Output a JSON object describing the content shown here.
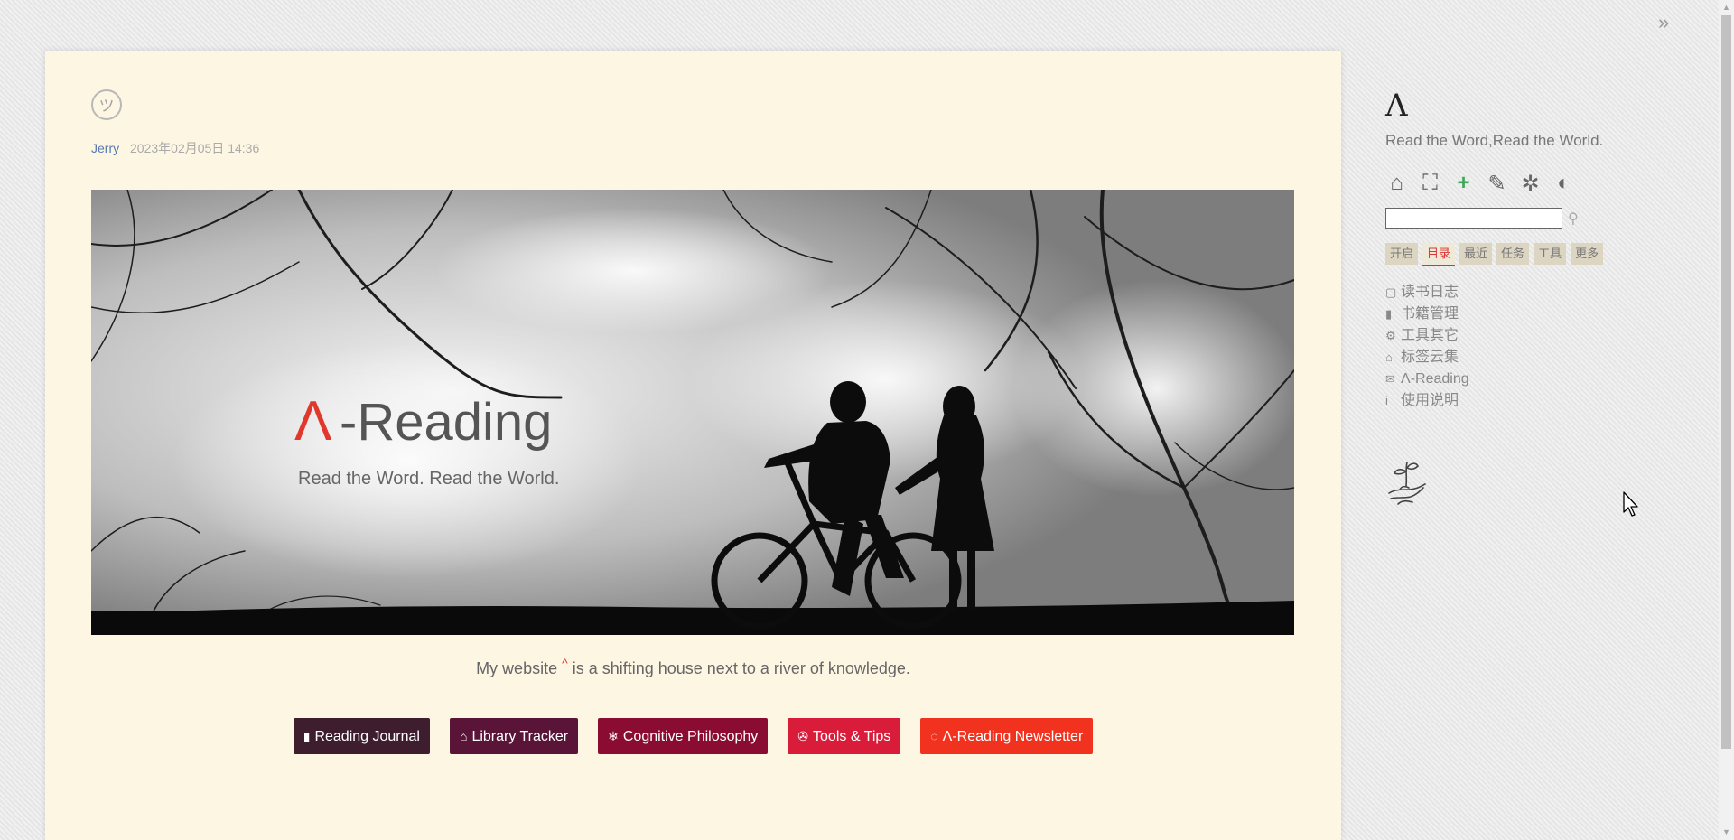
{
  "story": {
    "avatar_glyph": "ツ",
    "author": "Jerry",
    "date": "2023年02月05日 14:36",
    "banner": {
      "brand_glyph": "Λ",
      "brand_word": "-Reading",
      "brand_tagline": "Read the Word. Read the World."
    },
    "tagline_before": "My website",
    "tagline_sup": "^",
    "tagline_after": "is a shifting house next to a river of knowledge.",
    "buttons": [
      {
        "icon": "book-icon",
        "glyph": "▮",
        "label": "Reading Journal",
        "color": "#3e1d2e"
      },
      {
        "icon": "bank-icon",
        "glyph": "⌂",
        "label": "Library Tracker",
        "color": "#5a1438"
      },
      {
        "icon": "snowflake-icon",
        "glyph": "❄",
        "label": "Cognitive Philosophy",
        "color": "#8b0c33"
      },
      {
        "icon": "fire-icon",
        "glyph": "✇",
        "label": "Tools & Tips",
        "color": "#d91c3a"
      },
      {
        "icon": "comment-icon",
        "glyph": "◌",
        "label": "Λ-Reading Newsletter",
        "color": "#f0321f"
      }
    ]
  },
  "sidebar": {
    "site_title": "Λ",
    "site_subtitle": "Read the Word,Read the World.",
    "icon_bar": [
      {
        "icon": "home-icon",
        "glyph": "⌂"
      },
      {
        "icon": "fullscreen-icon",
        "glyph": "⛶"
      },
      {
        "icon": "new-tiddler-icon",
        "glyph": "+"
      },
      {
        "icon": "new-journal-icon",
        "glyph": "✎"
      },
      {
        "icon": "control-panel-icon",
        "glyph": "✲"
      },
      {
        "icon": "theme-toggle-icon",
        "glyph": "◐"
      }
    ],
    "search_placeholder": "",
    "tabs": [
      "开启",
      "目录",
      "最近",
      "任务",
      "工具",
      "更多"
    ],
    "active_tab": "目录",
    "menu": [
      {
        "icon": "file-icon",
        "glyph": "▢",
        "label": "读书日志"
      },
      {
        "icon": "book-icon",
        "glyph": "▮",
        "label": "书籍管理"
      },
      {
        "icon": "cogs-icon",
        "glyph": "⚙",
        "label": "工具其它"
      },
      {
        "icon": "tags-icon",
        "glyph": "⌂",
        "label": "标签云集"
      },
      {
        "icon": "envelope-icon",
        "glyph": "✉",
        "label": "Λ-Reading"
      },
      {
        "icon": "info-icon",
        "glyph": "i",
        "label": "使用说明"
      }
    ]
  },
  "colors": {
    "story_bg": "#fdf6e3",
    "accent_red": "#e0382d",
    "author_link": "#5778b2",
    "plus_green": "#3aa857"
  }
}
